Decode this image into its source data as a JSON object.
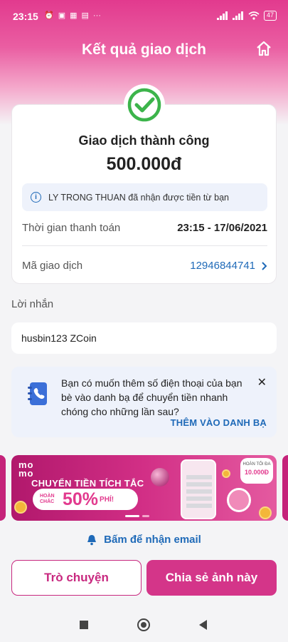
{
  "status_bar": {
    "time": "23:15",
    "battery": "47"
  },
  "header": {
    "title": "Kết quả giao dịch"
  },
  "result": {
    "status": "Giao dịch thành công",
    "amount": "500.000đ",
    "info": "LY TRONG THUAN đã nhận được tiền từ bạn",
    "rows": [
      {
        "label": "Thời gian thanh toán",
        "value": "23:15 - 17/06/2021"
      },
      {
        "label": "Mã giao dịch",
        "value": "12946844741"
      }
    ]
  },
  "message": {
    "label": "Lời nhắn",
    "value": "husbin123 ZCoin"
  },
  "suggestion": {
    "text": "Bạn có muốn thêm số điện thoại của bạn bè vào danh bạ để chuyển tiền nhanh chóng cho những lần sau?",
    "action": "THÊM VÀO DANH BẠ"
  },
  "banner": {
    "brand_top": "mo",
    "brand_bottom": "mo",
    "headline": "CHUYỂN TIỀN TÍCH TẮC",
    "sub": "HOÀN CHẮC",
    "percent": "50%",
    "percent_suffix": "PHÍ!",
    "badge_small": "HOÀN TỐI ĐA",
    "badge_value": "10.000Đ"
  },
  "email_link": "Bấm để nhận email",
  "buttons": {
    "chat": "Trò chuyện",
    "share": "Chia sẻ ảnh này"
  },
  "colors": {
    "brand": "#d43589",
    "link": "#1f6ab8",
    "success": "#3cb44b"
  }
}
